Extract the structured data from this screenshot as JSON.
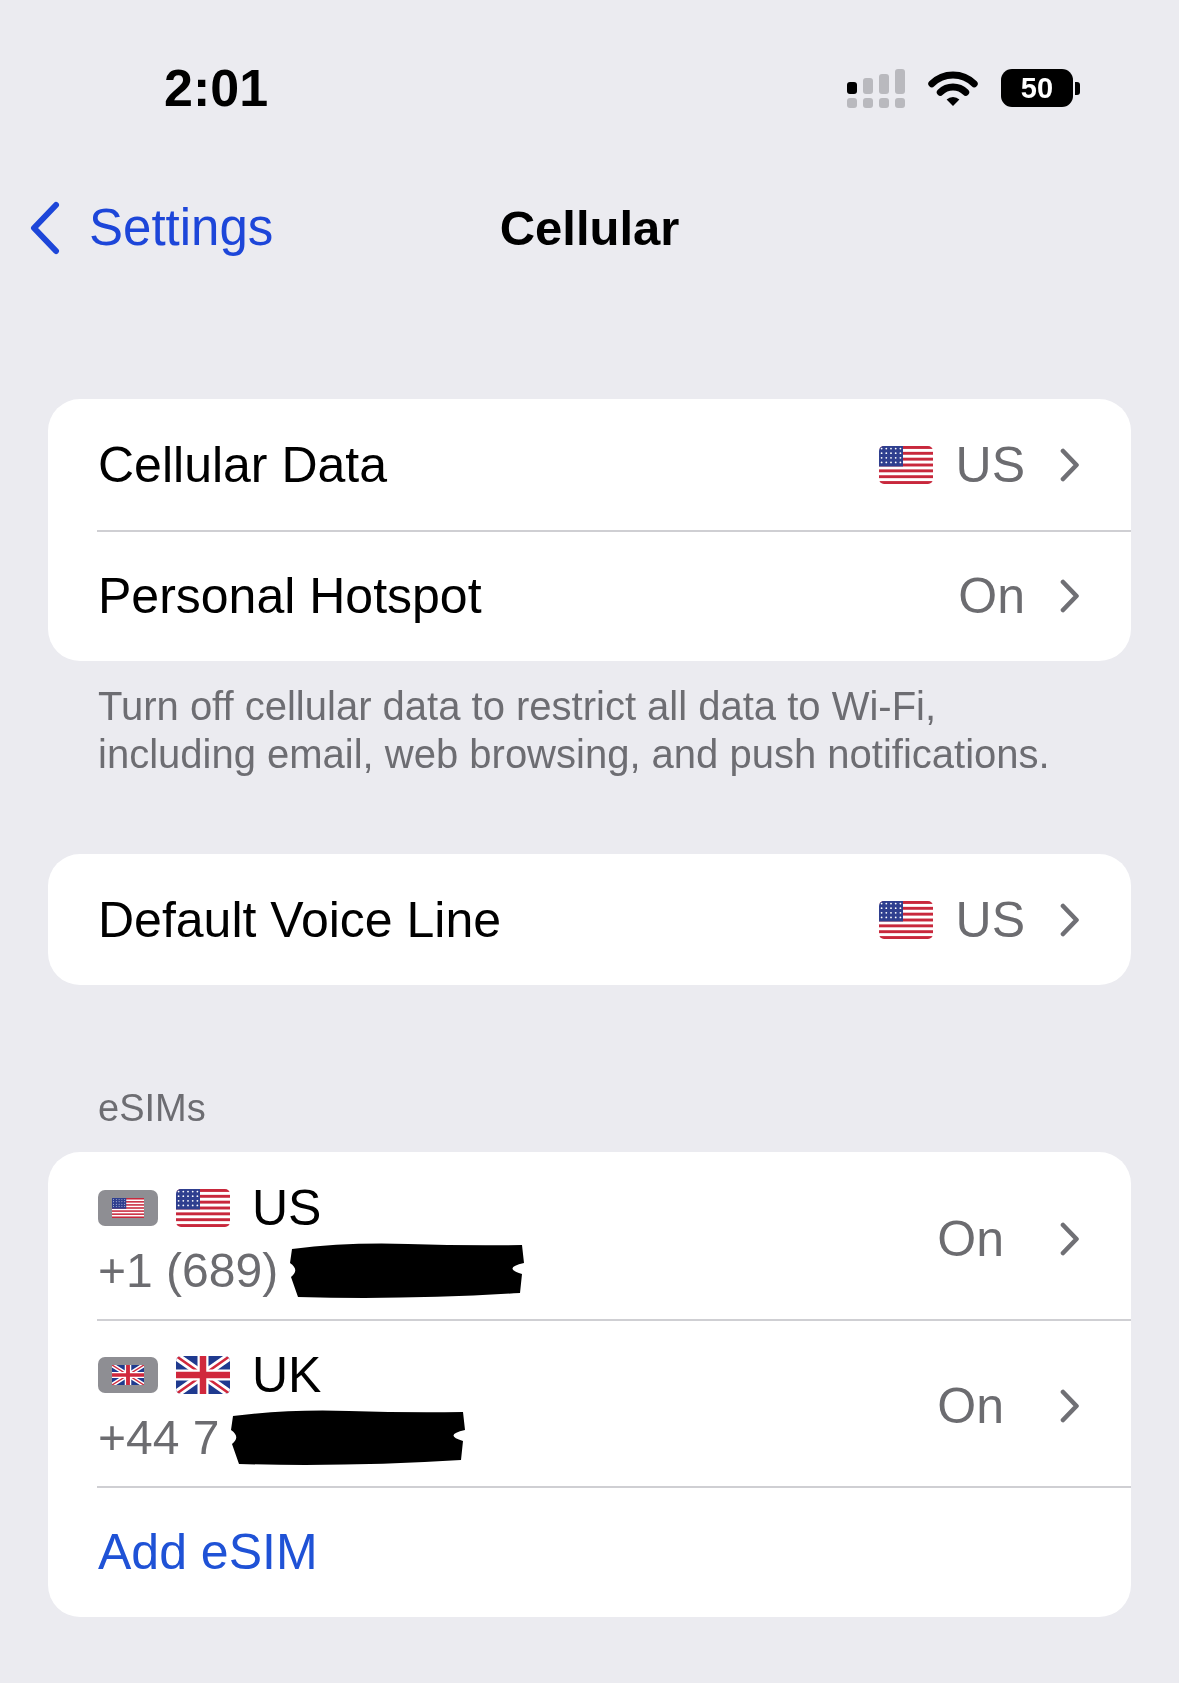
{
  "status_bar": {
    "time": "2:01",
    "battery": "50"
  },
  "nav_bar": {
    "back": "Settings",
    "title": "Cellular"
  },
  "sections": [
    {
      "kind": "group",
      "rows": [
        {
          "kind": "us",
          "label": "Cellular Data",
          "value": "US"
        },
        {
          "kind": "plain",
          "label": "Personal Hotspot",
          "value": "On"
        }
      ],
      "footer": "Turn off cellular data to restrict all data to Wi-Fi, including email, web browsing, and push notifications."
    },
    {
      "kind": "group",
      "rows": [
        {
          "kind": "us",
          "label": "Default Voice Line",
          "value": "US"
        }
      ]
    },
    {
      "kind": "esims",
      "header": "eSIMs",
      "lines": [
        {
          "kind": "us",
          "name": "US",
          "number": "+1 (689)",
          "redacted": true,
          "value": "On"
        },
        {
          "kind": "uk",
          "name": "UK",
          "number": "+44 7",
          "redacted": true,
          "value": "On"
        }
      ],
      "action": "Add eSIM"
    }
  ]
}
